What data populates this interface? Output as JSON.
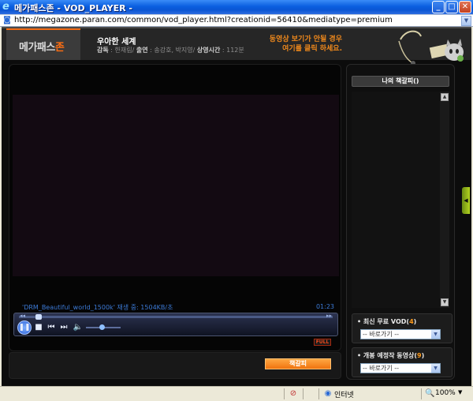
{
  "window": {
    "title": "메가패스존 - VOD_PLAYER -",
    "minimize_glyph": "_",
    "maximize_glyph": "□",
    "close_glyph": "✕"
  },
  "address": {
    "url": "http://megazone.paran.com/common/vod_player.html?creationid=56410&mediatype=premium"
  },
  "header": {
    "logo_main": "메가패스",
    "logo_accent": "존",
    "movie_title": "우아한 세계",
    "credits": {
      "director_label": "감독",
      "director": "한재림",
      "cast_label": "출연",
      "cast": "송강호, 박지영",
      "runtime_label": "상영시간",
      "runtime": "112분"
    },
    "notice_line1": "동영상 보기가 안될 경우",
    "notice_line2": "여기를 클릭 하세요."
  },
  "player": {
    "file_info": "'DRM_Beautiful_world_1500k' 재생 중: 1504KB/초",
    "time": "01:23",
    "seek_back": "◂◂",
    "seek_fwd": "▸▸",
    "full_label": "FULL",
    "progress_fraction": 0.02,
    "volume_fraction": 0.45
  },
  "bottom": {
    "bookmark_button": "책갈피"
  },
  "right_panel": {
    "bookmark_title": "나의 책갈피()",
    "free_vod": {
      "label": "최신 무료 VOD",
      "count": "4",
      "select_value": "-- 바로가기 --"
    },
    "upcoming": {
      "label": "개봉 예정작 동영상",
      "count": "9",
      "select_value": "-- 바로가기 --"
    }
  },
  "statusbar": {
    "zone": "인터넷",
    "zoom": "100%"
  }
}
